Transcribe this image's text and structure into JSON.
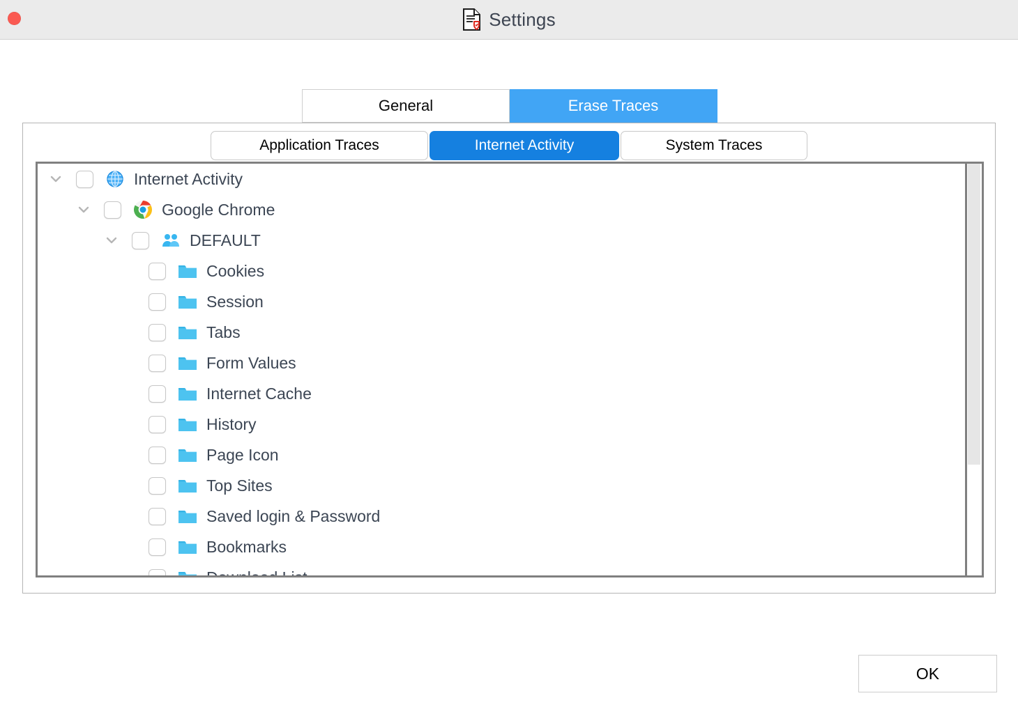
{
  "window": {
    "title": "Settings",
    "title_icon": "document-shield-icon",
    "close_button": "close-window-button",
    "titlebar_color": "#ebebeb",
    "close_color": "#fa5a52"
  },
  "outer_tabs": {
    "accent_color": "#41a5f5",
    "items": [
      {
        "label": "General",
        "active": false
      },
      {
        "label": "Erase Traces",
        "active": true
      }
    ]
  },
  "inner_tabs": {
    "accent_color": "#1580e0",
    "items": [
      {
        "label": "Application Traces",
        "active": false
      },
      {
        "label": "Internet Activity",
        "active": true
      },
      {
        "label": "System Traces",
        "active": false
      }
    ]
  },
  "tree": {
    "rows": [
      {
        "label": "Internet Activity",
        "depth": 0,
        "expanded": true,
        "checked": false,
        "icon": "globe-icon"
      },
      {
        "label": "Google Chrome",
        "depth": 1,
        "expanded": true,
        "checked": false,
        "icon": "chrome-icon"
      },
      {
        "label": "DEFAULT",
        "depth": 2,
        "expanded": true,
        "checked": false,
        "icon": "users-icon"
      },
      {
        "label": "Cookies",
        "depth": 3,
        "checked": false,
        "icon": "folder-icon"
      },
      {
        "label": "Session",
        "depth": 3,
        "checked": false,
        "icon": "folder-icon"
      },
      {
        "label": "Tabs",
        "depth": 3,
        "checked": false,
        "icon": "folder-icon"
      },
      {
        "label": "Form Values",
        "depth": 3,
        "checked": false,
        "icon": "folder-icon"
      },
      {
        "label": "Internet Cache",
        "depth": 3,
        "checked": false,
        "icon": "folder-icon"
      },
      {
        "label": "History",
        "depth": 3,
        "checked": false,
        "icon": "folder-icon"
      },
      {
        "label": "Page Icon",
        "depth": 3,
        "checked": false,
        "icon": "folder-icon"
      },
      {
        "label": "Top Sites",
        "depth": 3,
        "checked": false,
        "icon": "folder-icon"
      },
      {
        "label": "Saved login & Password",
        "depth": 3,
        "checked": false,
        "icon": "folder-icon"
      },
      {
        "label": "Bookmarks",
        "depth": 3,
        "checked": false,
        "icon": "folder-icon"
      },
      {
        "label": "Download List",
        "depth": 3,
        "checked": false,
        "icon": "folder-icon"
      }
    ]
  },
  "scrollbar": {
    "thumb_color": "#e6e6e6",
    "track_color": "#ffffff"
  },
  "footer": {
    "ok_label": "OK"
  }
}
